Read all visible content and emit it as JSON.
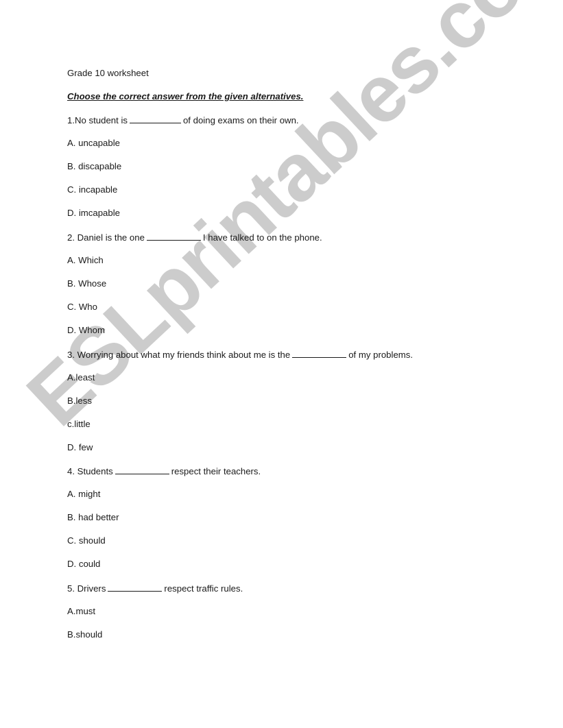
{
  "watermark": "ESLprintables.com",
  "title": "Grade 10 worksheet",
  "instruction": "Choose the correct answer from the given alternatives.",
  "questions": [
    {
      "before": "1.No student is",
      "after": "of doing exams on their own.",
      "options": [
        "A. uncapable",
        "B. discapable",
        "C. incapable",
        "D. imcapable"
      ]
    },
    {
      "before": "2. Daniel is the one",
      "after": "I have talked to on the phone.",
      "options": [
        "A. Which",
        "B. Whose",
        "C. Who",
        "D. Whom"
      ]
    },
    {
      "before": "3. Worrying about what my friends think about me is the",
      "after": "of my problems.",
      "options": [
        "A.least",
        "B.less",
        "c.little",
        "D. few"
      ]
    },
    {
      "before": "4. Students",
      "after": "respect their teachers.",
      "options": [
        "A. might",
        "B. had better",
        "C. should",
        "D. could"
      ]
    },
    {
      "before": "5. Drivers",
      "after": "respect traffic rules.",
      "options": [
        "A.must",
        "B.should"
      ]
    }
  ]
}
